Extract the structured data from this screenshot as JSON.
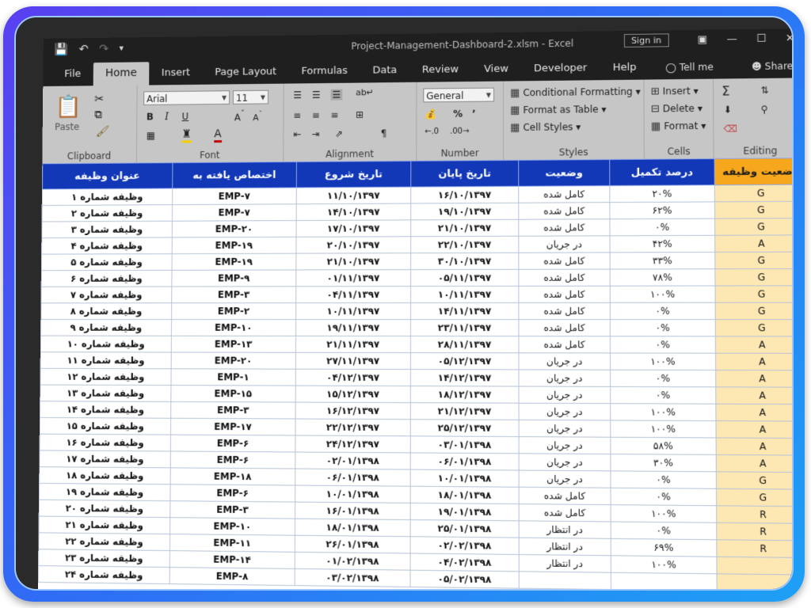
{
  "titlebar": {
    "doc_title": "Project-Management-Dashboard-2.xlsm  -  Excel",
    "sign_in": "Sign in"
  },
  "tabs": [
    "File",
    "Home",
    "Insert",
    "Page Layout",
    "Formulas",
    "Data",
    "Review",
    "View",
    "Developer",
    "Help"
  ],
  "tell_me": "Tell me",
  "share": "Share",
  "ribbon": {
    "clipboard": {
      "paste": "Paste",
      "label": "Clipboard"
    },
    "font": {
      "name": "Arial",
      "size": "11",
      "label": "Font"
    },
    "alignment": {
      "label": "Alignment"
    },
    "number": {
      "format": "General",
      "label": "Number"
    },
    "styles": {
      "conditional": "Conditional Formatting",
      "format_table": "Format as Table",
      "cell_styles": "Cell Styles",
      "label": "Styles"
    },
    "cells": {
      "insert": "Insert",
      "delete": "Delete",
      "format": "Format",
      "label": "Cells"
    },
    "editing": {
      "label": "Editing"
    }
  },
  "headers": [
    "عنوان وظیفه",
    "اختصاص یافته به",
    "تاریخ شروع",
    "تاریخ پایان",
    "وضعیت",
    "درصد تکمیل",
    "وضعیت وظیفه"
  ],
  "rows": [
    [
      "وظیفه شماره ۱",
      "EMP-۷",
      "۱۱/۱۰/۱۳۹۷",
      "۱۶/۱۰/۱۳۹۷",
      "کامل شده",
      "۲۰%",
      "G"
    ],
    [
      "وظیفه شماره ۲",
      "EMP-۷",
      "۱۴/۱۰/۱۳۹۷",
      "۱۹/۱۰/۱۳۹۷",
      "کامل شده",
      "۶۲%",
      "G"
    ],
    [
      "وظیفه شماره ۳",
      "EMP-۲۰",
      "۱۷/۱۰/۱۳۹۷",
      "۲۱/۱۰/۱۳۹۷",
      "کامل شده",
      "۰%",
      "G"
    ],
    [
      "وظیفه شماره ۴",
      "EMP-۱۹",
      "۲۰/۱۰/۱۳۹۷",
      "۲۲/۱۰/۱۳۹۷",
      "در جریان",
      "۴۲%",
      "A"
    ],
    [
      "وظیفه شماره ۵",
      "EMP-۱۹",
      "۲۱/۱۰/۱۳۹۷",
      "۳۰/۱۰/۱۳۹۷",
      "کامل شده",
      "۳۳%",
      "G"
    ],
    [
      "وظیفه شماره ۶",
      "EMP-۹",
      "۰۱/۱۱/۱۳۹۷",
      "۰۵/۱۱/۱۳۹۷",
      "کامل شده",
      "۷۸%",
      "G"
    ],
    [
      "وظیفه شماره ۷",
      "EMP-۳",
      "۰۴/۱۱/۱۳۹۷",
      "۱۰/۱۱/۱۳۹۷",
      "کامل شده",
      "۱۰۰%",
      "G"
    ],
    [
      "وظیفه شماره ۸",
      "EMP-۲",
      "۱۰/۱۱/۱۳۹۷",
      "۱۴/۱۱/۱۳۹۷",
      "کامل شده",
      "۰%",
      "G"
    ],
    [
      "وظیفه شماره ۹",
      "EMP-۱۰",
      "۱۹/۱۱/۱۳۹۷",
      "۲۳/۱۱/۱۳۹۷",
      "کامل شده",
      "۰%",
      "G"
    ],
    [
      "وظیفه شماره ۱۰",
      "EMP-۱۳",
      "۲۱/۱۱/۱۳۹۷",
      "۲۸/۱۱/۱۳۹۷",
      "کامل شده",
      "۰%",
      "A"
    ],
    [
      "وظیفه شماره ۱۱",
      "EMP-۲۰",
      "۲۷/۱۱/۱۳۹۷",
      "۰۵/۱۲/۱۳۹۷",
      "در جریان",
      "۱۰۰%",
      "A"
    ],
    [
      "وظیفه شماره ۱۲",
      "EMP-۱",
      "۰۴/۱۲/۱۳۹۷",
      "۱۴/۱۲/۱۳۹۷",
      "در جریان",
      "۰%",
      "A"
    ],
    [
      "وظیفه شماره ۱۳",
      "EMP-۱۵",
      "۱۵/۱۲/۱۳۹۷",
      "۱۸/۱۲/۱۳۹۷",
      "در جریان",
      "۰%",
      "A"
    ],
    [
      "وظیفه شماره ۱۴",
      "EMP-۳",
      "۱۶/۱۲/۱۳۹۷",
      "۲۱/۱۲/۱۳۹۷",
      "در جریان",
      "۱۰۰%",
      "A"
    ],
    [
      "وظیفه شماره ۱۵",
      "EMP-۱۷",
      "۲۲/۱۲/۱۳۹۷",
      "۲۵/۱۲/۱۳۹۷",
      "در جریان",
      "۱۰۰%",
      "A"
    ],
    [
      "وظیفه شماره ۱۶",
      "EMP-۶",
      "۲۴/۱۲/۱۳۹۷",
      "۰۳/۰۱/۱۳۹۸",
      "در جریان",
      "۵۸%",
      "A"
    ],
    [
      "وظیفه شماره ۱۷",
      "EMP-۶",
      "۰۲/۰۱/۱۳۹۸",
      "۰۶/۰۱/۱۳۹۸",
      "در جریان",
      "۳۰%",
      "A"
    ],
    [
      "وظیفه شماره ۱۸",
      "EMP-۱۸",
      "۰۶/۰۱/۱۳۹۸",
      "۱۰/۰۱/۱۳۹۸",
      "در جریان",
      "۰%",
      "G"
    ],
    [
      "وظیفه شماره ۱۹",
      "EMP-۶",
      "۱۰/۰۱/۱۳۹۸",
      "۱۸/۰۱/۱۳۹۸",
      "کامل شده",
      "۰%",
      "G"
    ],
    [
      "وظیفه شماره ۲۰",
      "EMP-۳",
      "۱۶/۰۱/۱۳۹۸",
      "۱۹/۰۱/۱۳۹۸",
      "کامل شده",
      "۱۰۰%",
      "R"
    ],
    [
      "وظیفه شماره ۲۱",
      "EMP-۱۰",
      "۱۸/۰۱/۱۳۹۸",
      "۲۵/۰۱/۱۳۹۸",
      "در انتظار",
      "۰%",
      "R"
    ],
    [
      "وظیفه شماره ۲۲",
      "EMP-۱۱",
      "۲۶/۰۱/۱۳۹۸",
      "۰۲/۰۲/۱۳۹۸",
      "در انتظار",
      "۶۹%",
      "R"
    ],
    [
      "وظیفه شماره ۲۳",
      "EMP-۱۴",
      "۰۱/۰۲/۱۳۹۸",
      "۰۴/۰۲/۱۳۹۸",
      "در انتظار",
      "۱۰۰%",
      ""
    ],
    [
      "وظیفه شماره ۲۴",
      "EMP-۸",
      "۰۳/۰۲/۱۳۹۸",
      "۰۵/۰۲/۱۳۹۸",
      "",
      "",
      ""
    ]
  ],
  "colors": {
    "header_blue": "#1238b8",
    "status_header_orange": "#f6a71c",
    "status_cell_bg": "#fde7b3",
    "frame_gradient_start": "#5a3ff0",
    "frame_gradient_end": "#1ea0f5"
  }
}
